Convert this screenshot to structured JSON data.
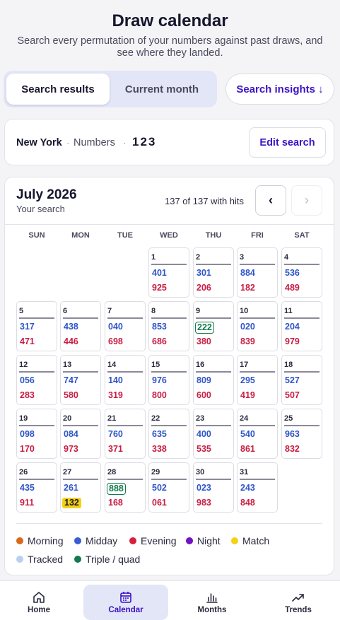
{
  "header": {
    "title": "Draw calendar",
    "subtitle_line1": "Search every permutation of your numbers against past draws, and",
    "subtitle_line2": "see where they landed."
  },
  "segmented": {
    "active_label": "Search results",
    "inactive_label": "Current month",
    "insights_label": "Search insights ↓"
  },
  "search_card": {
    "state": "New York",
    "numbers_label": "Numbers",
    "separator": "·",
    "numbers": "123",
    "edit_label": "Edit search"
  },
  "calendar": {
    "month": "July 2026",
    "subtitle": "Your search",
    "hits_text": "137 of 137 with hits",
    "prev_symbol": "‹",
    "next_symbol": "›",
    "weekdays": [
      "SUN",
      "MON",
      "TUE",
      "WED",
      "THU",
      "FRI",
      "SAT"
    ],
    "first_weekday_index": 3,
    "days": [
      {
        "day": "1",
        "midday": "401",
        "evening": "925"
      },
      {
        "day": "2",
        "midday": "301",
        "evening": "206"
      },
      {
        "day": "3",
        "midday": "884",
        "evening": "182"
      },
      {
        "day": "4",
        "midday": "536",
        "evening": "489"
      },
      {
        "day": "5",
        "midday": "317",
        "evening": "471"
      },
      {
        "day": "6",
        "midday": "438",
        "evening": "446"
      },
      {
        "day": "7",
        "midday": "040",
        "evening": "698"
      },
      {
        "day": "8",
        "midday": "853",
        "evening": "686"
      },
      {
        "day": "9",
        "midday": "222",
        "evening": "380",
        "midday_triple": true
      },
      {
        "day": "10",
        "midday": "020",
        "evening": "839"
      },
      {
        "day": "11",
        "midday": "204",
        "evening": "979"
      },
      {
        "day": "12",
        "midday": "056",
        "evening": "283"
      },
      {
        "day": "13",
        "midday": "747",
        "evening": "580"
      },
      {
        "day": "14",
        "midday": "140",
        "evening": "319"
      },
      {
        "day": "15",
        "midday": "976",
        "evening": "800"
      },
      {
        "day": "16",
        "midday": "809",
        "evening": "600"
      },
      {
        "day": "17",
        "midday": "295",
        "evening": "419"
      },
      {
        "day": "18",
        "midday": "527",
        "evening": "507"
      },
      {
        "day": "19",
        "midday": "098",
        "evening": "170"
      },
      {
        "day": "20",
        "midday": "084",
        "evening": "973"
      },
      {
        "day": "21",
        "midday": "760",
        "evening": "371"
      },
      {
        "day": "22",
        "midday": "635",
        "evening": "338"
      },
      {
        "day": "23",
        "midday": "400",
        "evening": "535"
      },
      {
        "day": "24",
        "midday": "540",
        "evening": "861"
      },
      {
        "day": "25",
        "midday": "963",
        "evening": "832"
      },
      {
        "day": "26",
        "midday": "435",
        "evening": "911"
      },
      {
        "day": "27",
        "midday": "261",
        "evening": "132",
        "evening_match": true
      },
      {
        "day": "28",
        "midday": "888",
        "evening": "168",
        "midday_triple": true
      },
      {
        "day": "29",
        "midday": "502",
        "evening": "061"
      },
      {
        "day": "30",
        "midday": "023",
        "evening": "983"
      },
      {
        "day": "31",
        "midday": "243",
        "evening": "848"
      }
    ]
  },
  "legend": [
    {
      "label": "Morning",
      "color": "#d9691e"
    },
    {
      "label": "Midday",
      "color": "#3a5ed0"
    },
    {
      "label": "Evening",
      "color": "#d4213d"
    },
    {
      "label": "Night",
      "color": "#7212c4"
    },
    {
      "label": "Match",
      "color": "#f4d116"
    },
    {
      "label": "Tracked",
      "color": "#b8d0f0"
    },
    {
      "label": "Triple / quad",
      "color": "#137a4d"
    }
  ],
  "tabs": [
    {
      "label": "Home",
      "icon": "home-icon"
    },
    {
      "label": "Calendar",
      "icon": "calendar-icon",
      "active": true
    },
    {
      "label": "Months",
      "icon": "bar-chart-icon"
    },
    {
      "label": "Trends",
      "icon": "trend-up-icon"
    }
  ],
  "colors": {
    "accent": "#3b12c4",
    "midday": "#2f55c8",
    "evening": "#c81e44",
    "triple": "#137a4d",
    "match": "#f4d116"
  }
}
